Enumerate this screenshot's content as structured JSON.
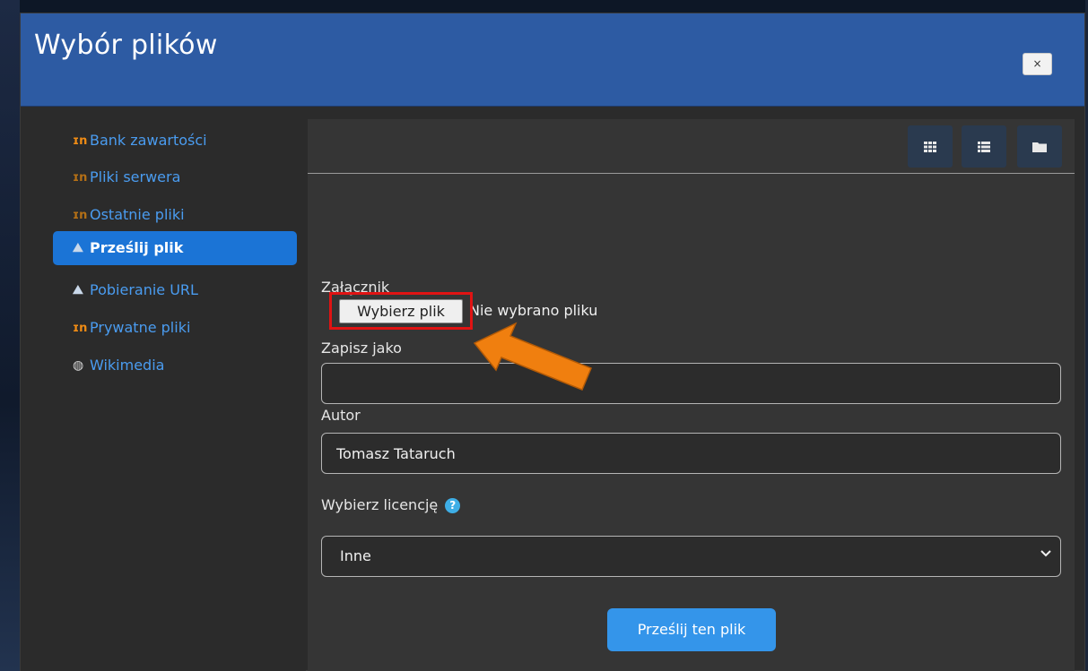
{
  "modal": {
    "title": "Wybór plików",
    "close_label": "×"
  },
  "sidebar": {
    "items": [
      {
        "label": "Bank zawartości",
        "icon": "moodle-icon",
        "active": false
      },
      {
        "label": "Pliki serwera",
        "icon": "moodle-icon",
        "active": false
      },
      {
        "label": "Ostatnie pliki",
        "icon": "moodle-icon",
        "active": false
      },
      {
        "label": "Prześlij plik",
        "icon": "upload-icon",
        "active": true
      },
      {
        "label": "Pobieranie URL",
        "icon": "upload-icon",
        "active": false
      },
      {
        "label": "Prywatne pliki",
        "icon": "moodle-icon",
        "active": false
      },
      {
        "label": "Wikimedia",
        "icon": "wikimedia-icon",
        "active": false
      }
    ]
  },
  "toolbar": {
    "view_icons": [
      "grid-view-icon",
      "list-view-icon",
      "folder-view-icon"
    ]
  },
  "form": {
    "attachment_label": "Załącznik",
    "choose_file_label": "Wybierz plik",
    "no_file_text": "Nie wybrano pliku",
    "save_as_label": "Zapisz jako",
    "save_as_value": "",
    "author_label": "Autor",
    "author_value": "Tomasz Tataruch",
    "license_label": "Wybierz licencję",
    "license_value": "Inne",
    "submit_label": "Prześlij ten plik"
  },
  "colors": {
    "header": "#2d5ba3",
    "active_item": "#1b74d6",
    "link": "#4a9cf0",
    "highlight_box": "#e01313",
    "arrow": "#f07f0f",
    "submit": "#3495ea"
  }
}
